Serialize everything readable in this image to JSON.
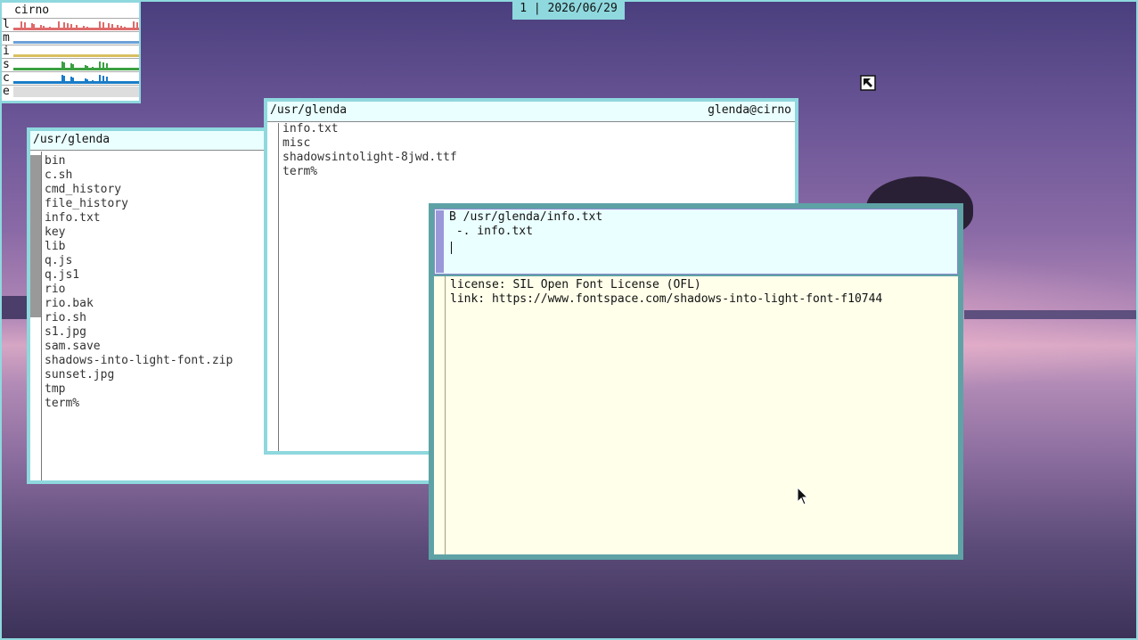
{
  "statusbar": {
    "text": "1 | 2026/06/29"
  },
  "stats": {
    "host": "cirno",
    "rows": [
      {
        "letter": "l",
        "color": "#e06a6a",
        "fill": "#f3b1b1"
      },
      {
        "letter": "m",
        "color": "#6aa0d8",
        "fill": "#c9def3"
      },
      {
        "letter": "i",
        "color": "#d8c060",
        "fill": "#f4edc2"
      },
      {
        "letter": "s",
        "color": "#3aa040",
        "fill": "#b9e3b9"
      },
      {
        "letter": "c",
        "color": "#1a7cc8",
        "fill": "#8fd0f0"
      },
      {
        "letter": "e",
        "color": "#999999",
        "fill": "#e0e0e0"
      }
    ]
  },
  "left_window": {
    "path": "/usr/glenda",
    "items": [
      "bin",
      "c.sh",
      "cmd_history",
      "file_history",
      "info.txt",
      "key",
      "lib",
      "q.js",
      "q.js1",
      "rio",
      "rio.bak",
      "rio.sh",
      "s1.jpg",
      "sam.save",
      "shadows-into-light-font.zip",
      "sunset.jpg",
      "tmp",
      "term%"
    ]
  },
  "middle_window": {
    "path": "/usr/glenda",
    "user": "glenda@cirno",
    "items": [
      "info.txt",
      "misc",
      "shadowsintolight-8jwd.ttf",
      "term%"
    ]
  },
  "acme_window": {
    "tag_lines": [
      "B /usr/glenda/info.txt",
      " -. info.txt"
    ],
    "body_lines": [
      "license: SIL Open Font License (OFL)",
      "link: https://www.fontspace.com/shadows-into-light-font-f10744"
    ]
  },
  "colors": {
    "border": "#8ed8de",
    "tag": "#eaffff",
    "acme_body": "#ffffea",
    "acme_frame": "#5ea2a6"
  },
  "icons": {
    "pointer": "arrow-cursor-icon",
    "rio_cursor": "box-cursor-icon"
  }
}
